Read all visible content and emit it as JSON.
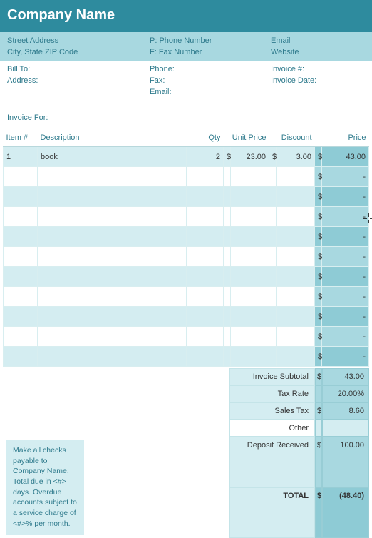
{
  "header": {
    "company_name": "Company Name"
  },
  "info": {
    "street": "Street Address",
    "phone_prefix": "P: Phone Number",
    "email": "Email",
    "city": "City, State ZIP Code",
    "fax_prefix": "F: Fax Number",
    "website": "Website"
  },
  "meta": {
    "bill_to": "Bill To:",
    "address": "Address:",
    "phone": "Phone:",
    "fax": "Fax:",
    "email": "Email:",
    "invoice_no": "Invoice #:",
    "invoice_date": "Invoice Date:"
  },
  "invoice_for_label": "Invoice For:",
  "columns": {
    "item": "Item #",
    "desc": "Description",
    "qty": "Qty",
    "unit": "Unit Price",
    "disc": "Discount",
    "price": "Price"
  },
  "rows": [
    {
      "item": "1",
      "desc": "book",
      "qty": "2",
      "unit": "23.00",
      "disc": "3.00",
      "price": "43.00"
    },
    {
      "item": "",
      "desc": "",
      "qty": "",
      "unit": "",
      "disc": "",
      "price": "-"
    },
    {
      "item": "",
      "desc": "",
      "qty": "",
      "unit": "",
      "disc": "",
      "price": "-"
    },
    {
      "item": "",
      "desc": "",
      "qty": "",
      "unit": "",
      "disc": "",
      "price": "-"
    },
    {
      "item": "",
      "desc": "",
      "qty": "",
      "unit": "",
      "disc": "",
      "price": "-"
    },
    {
      "item": "",
      "desc": "",
      "qty": "",
      "unit": "",
      "disc": "",
      "price": "-"
    },
    {
      "item": "",
      "desc": "",
      "qty": "",
      "unit": "",
      "disc": "",
      "price": "-"
    },
    {
      "item": "",
      "desc": "",
      "qty": "",
      "unit": "",
      "disc": "",
      "price": "-"
    },
    {
      "item": "",
      "desc": "",
      "qty": "",
      "unit": "",
      "disc": "",
      "price": "-"
    },
    {
      "item": "",
      "desc": "",
      "qty": "",
      "unit": "",
      "disc": "",
      "price": "-"
    },
    {
      "item": "",
      "desc": "",
      "qty": "",
      "unit": "",
      "disc": "",
      "price": "-"
    }
  ],
  "totals": {
    "subtotal_label": "Invoice Subtotal",
    "subtotal": "43.00",
    "tax_rate_label": "Tax Rate",
    "tax_rate": "20.00%",
    "sales_tax_label": "Sales Tax",
    "sales_tax": "8.60",
    "other_label": "Other",
    "other": "",
    "deposit_label": "Deposit Received",
    "deposit": "100.00",
    "total_label": "TOTAL",
    "total": "(48.40)"
  },
  "footer": {
    "line1": "Make all checks payable to Company Name.",
    "line2": "Total due in <#> days. Overdue accounts subject to a service charge of <#>% per month."
  },
  "chart_data": {
    "type": "table",
    "title": "Invoice",
    "columns": [
      "Item #",
      "Description",
      "Qty",
      "Unit Price",
      "Discount",
      "Price"
    ],
    "rows": [
      [
        "1",
        "book",
        2,
        23.0,
        3.0,
        43.0
      ]
    ],
    "summary": {
      "Invoice Subtotal": 43.0,
      "Tax Rate": "20.00%",
      "Sales Tax": 8.6,
      "Other": null,
      "Deposit Received": 100.0,
      "TOTAL": -48.4
    }
  }
}
